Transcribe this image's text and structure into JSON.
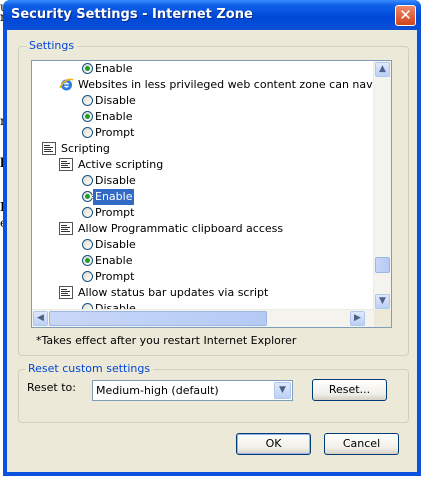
{
  "window": {
    "title": "Security Settings - Internet Zone"
  },
  "background": {
    "glyphs": [
      "u",
      "n",
      "rs",
      "h",
      "I",
      "e"
    ]
  },
  "settings_group": {
    "label": "Settings"
  },
  "tree_items": [
    {
      "kind": "radio",
      "label": "Enable",
      "selected": true
    },
    {
      "kind": "ie-header",
      "label": "Websites in less privileged web content zone can navigate in"
    },
    {
      "kind": "radio",
      "label": "Disable",
      "selected": false
    },
    {
      "kind": "radio",
      "label": "Enable",
      "selected": true
    },
    {
      "kind": "radio",
      "label": "Prompt",
      "selected": false
    },
    {
      "kind": "category",
      "label": "Scripting"
    },
    {
      "kind": "sub-header",
      "label": "Active scripting"
    },
    {
      "kind": "radio",
      "label": "Disable",
      "selected": false
    },
    {
      "kind": "radio",
      "label": "Enable",
      "selected": true,
      "highlighted": true
    },
    {
      "kind": "radio",
      "label": "Prompt",
      "selected": false
    },
    {
      "kind": "sub-header",
      "label": "Allow Programmatic clipboard access"
    },
    {
      "kind": "radio",
      "label": "Disable",
      "selected": false
    },
    {
      "kind": "radio",
      "label": "Enable",
      "selected": true
    },
    {
      "kind": "radio",
      "label": "Prompt",
      "selected": false
    },
    {
      "kind": "sub-header",
      "label": "Allow status bar updates via script"
    },
    {
      "kind": "radio",
      "label": "Disable",
      "selected": false
    }
  ],
  "note": "*Takes effect after you restart Internet Explorer",
  "reset_group": {
    "label": "Reset custom settings",
    "reset_to_label": "Reset to:",
    "selected_level": "Medium-high (default)",
    "reset_button": "Reset..."
  },
  "buttons": {
    "ok": "OK",
    "cancel": "Cancel"
  },
  "icons": {
    "close": "close-icon",
    "scroll_up": "scroll-up-icon",
    "scroll_down": "scroll-down-icon"
  }
}
